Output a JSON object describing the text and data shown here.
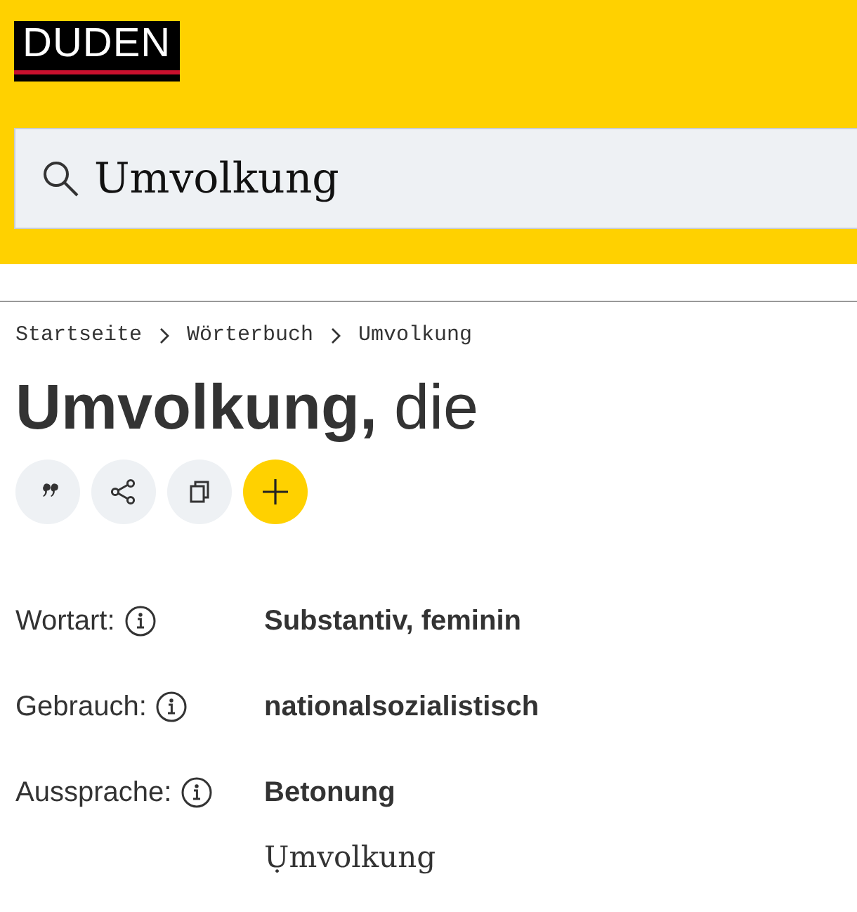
{
  "header": {
    "logo": "DUDEN",
    "search": {
      "value": "Umvolkung"
    }
  },
  "breadcrumb": [
    {
      "label": "Startseite"
    },
    {
      "label": "Wörterbuch"
    },
    {
      "label": "Umvolkung"
    }
  ],
  "entry": {
    "headword": "Umvolkung,",
    "article": "die"
  },
  "actions": [
    {
      "kind": "cite"
    },
    {
      "kind": "share"
    },
    {
      "kind": "copy"
    },
    {
      "kind": "add"
    }
  ],
  "properties": [
    {
      "label": "Wortart:",
      "value": "Substantiv, feminin"
    },
    {
      "label": "Gebrauch:",
      "value": "nationalsozialistisch"
    },
    {
      "label": "Aussprache:",
      "value": "Betonung",
      "detail": "Ụmvolkung"
    }
  ]
}
